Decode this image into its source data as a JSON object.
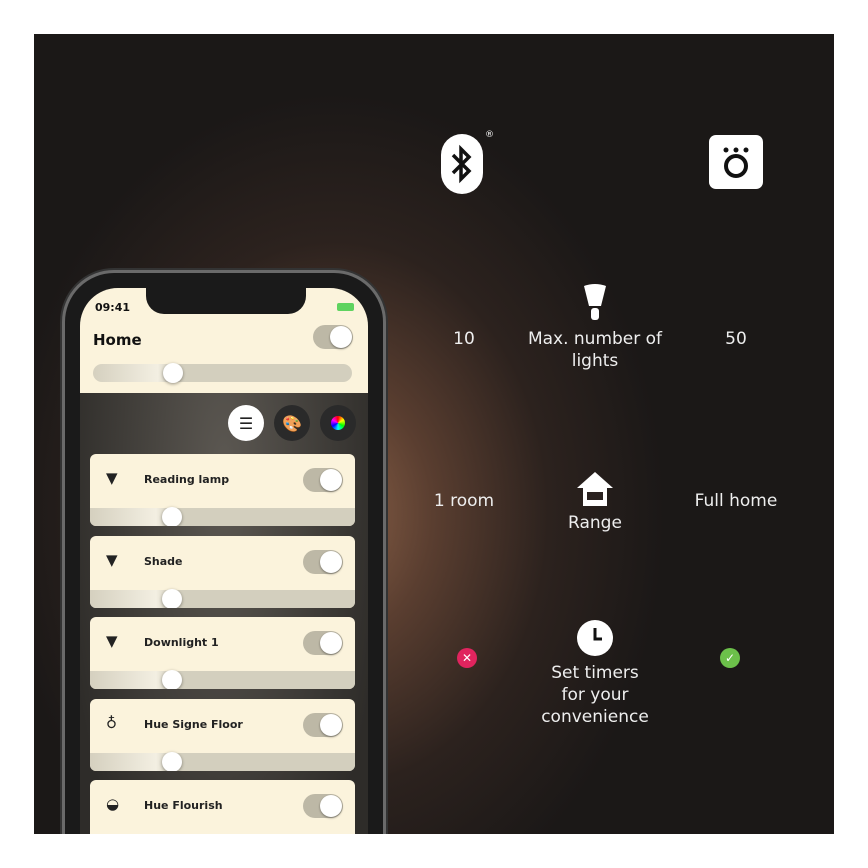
{
  "phone": {
    "time": "09:41",
    "home": {
      "title": "Home",
      "on": true,
      "brightness": 0.3
    },
    "view_buttons": [
      {
        "icon": "list-icon",
        "active": true
      },
      {
        "icon": "palette-icon",
        "active": false
      },
      {
        "icon": "color-picker-icon",
        "active": false
      }
    ],
    "lights": [
      {
        "name": "Reading lamp",
        "on": true,
        "brightness": 0.3
      },
      {
        "name": "Shade",
        "on": true,
        "brightness": 0.3
      },
      {
        "name": "Downlight 1",
        "on": true,
        "brightness": 0.3
      },
      {
        "name": "Hue Signe Floor",
        "on": true,
        "brightness": 0.3
      },
      {
        "name": "Hue Flourish",
        "on": true
      }
    ]
  },
  "comparison": {
    "columns": [
      {
        "icon": "bluetooth-icon",
        "mark": "®"
      },
      {
        "icon": "hue-bridge-icon"
      }
    ],
    "rows": [
      {
        "icon": "bulb-icon",
        "label": "Max. number of lights",
        "left": "10",
        "right": "50"
      },
      {
        "icon": "house-icon",
        "label": "Range",
        "left": "1 room",
        "right": "Full home"
      },
      {
        "icon": "clock-icon",
        "label_lines": [
          "Set timers",
          "for your",
          "convenience"
        ],
        "left_icon": "cross-icon",
        "right_icon": "check-icon"
      }
    ]
  },
  "colors": {
    "cross": "#e0245e",
    "check": "#6cc04a",
    "card": "#fbf3dc"
  }
}
